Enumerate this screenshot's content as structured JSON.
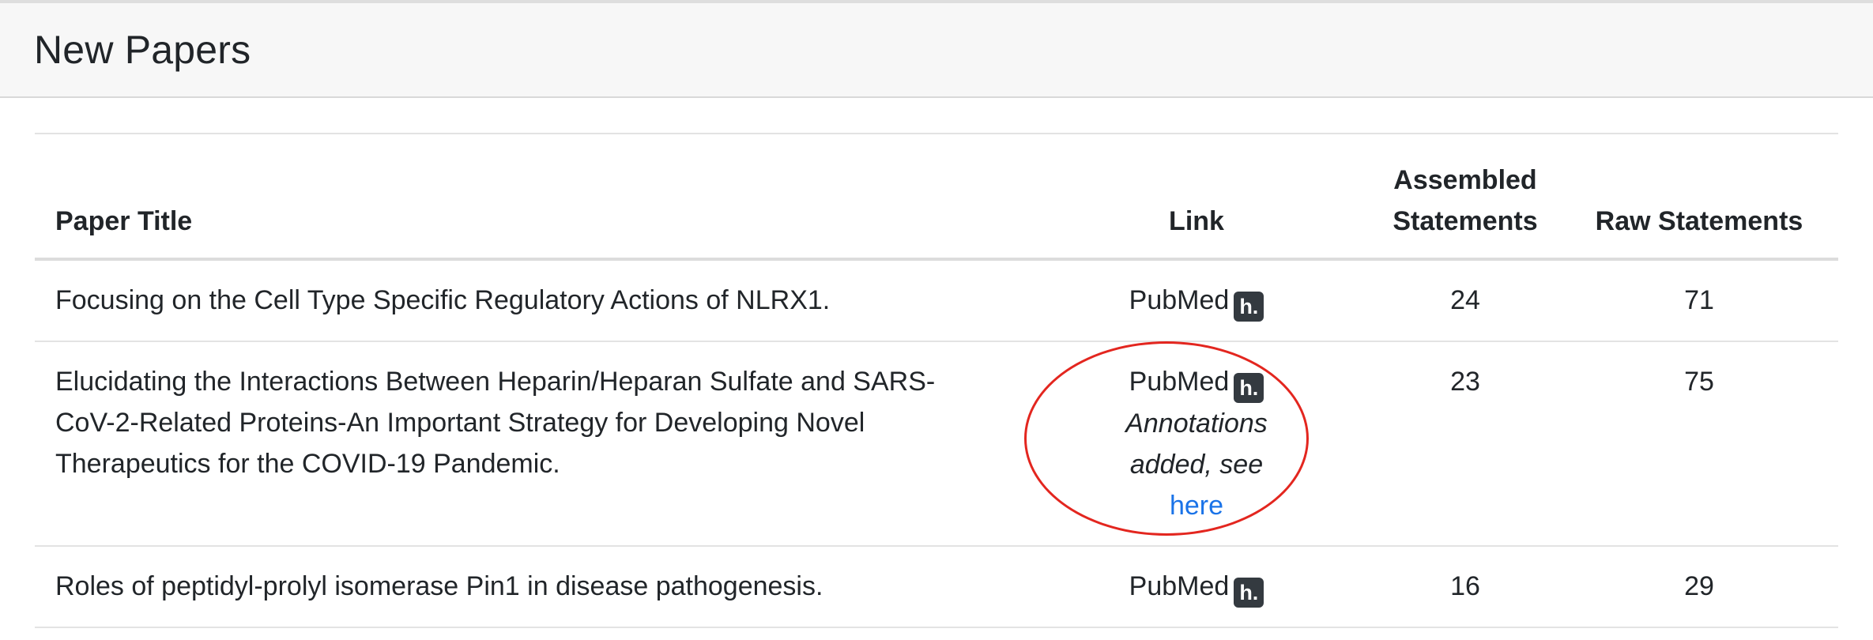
{
  "header": {
    "title": "New Papers"
  },
  "table": {
    "columns": {
      "title": "Paper Title",
      "link": "Link",
      "assembled_line1": "Assembled",
      "assembled_line2": "Statements",
      "raw": "Raw Statements"
    },
    "rows": [
      {
        "title": "Focusing on the Cell Type Specific Regulatory Actions of NLRX1.",
        "link": "PubMed",
        "hypothesis": "h.",
        "assembled": "24",
        "raw": "71"
      },
      {
        "title": "Elucidating the Interactions Between Heparin/Heparan Sulfate and SARS-CoV-2-Related Proteins-An Important Strategy for Developing Novel Therapeutics for the COVID-19 Pandemic.",
        "link": "PubMed",
        "hypothesis": "h.",
        "annotation_note": "Annotations added, see",
        "annotation_link": "here",
        "assembled": "23",
        "raw": "75"
      },
      {
        "title": "Roles of peptidyl-prolyl isomerase Pin1 in disease pathogenesis.",
        "link": "PubMed",
        "hypothesis": "h.",
        "assembled": "16",
        "raw": "29"
      }
    ]
  },
  "colors": {
    "link_blue": "#1a73e8",
    "badge_dark": "#343a40",
    "highlight_circle": "#e3261f"
  }
}
